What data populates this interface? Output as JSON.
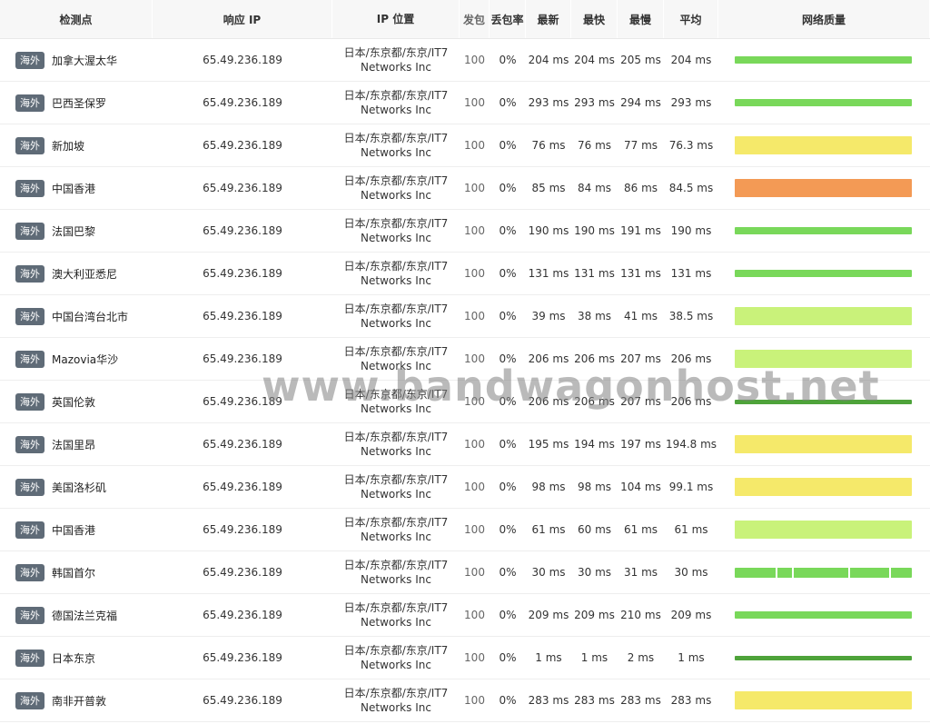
{
  "columns": {
    "node": "检测点",
    "ip": "响应 IP",
    "location": "IP 位置",
    "sent": "发包",
    "loss": "丢包率",
    "latest": "最新",
    "fastest": "最快",
    "slowest": "最慢",
    "average": "平均",
    "quality": "网络质量"
  },
  "colors": {
    "green": "#79d85a",
    "dark_green": "#4ea33a",
    "light_green": "#c9f27a",
    "yellow": "#f5e96a",
    "orange": "#f39a55",
    "tag_bg": "#5f6b77"
  },
  "rows": [
    {
      "tag": "海外",
      "node": "加拿大渥太华",
      "ip": "65.49.236.189",
      "loc1": "日本/东京都/东京/IT7",
      "loc2": "Networks Inc",
      "sent": "100",
      "loss": "0%",
      "latest": "204 ms",
      "fastest": "204 ms",
      "slowest": "205 ms",
      "average": "204 ms",
      "quality": "green"
    },
    {
      "tag": "海外",
      "node": "巴西圣保罗",
      "ip": "65.49.236.189",
      "loc1": "日本/东京都/东京/IT7",
      "loc2": "Networks Inc",
      "sent": "100",
      "loss": "0%",
      "latest": "293 ms",
      "fastest": "293 ms",
      "slowest": "294 ms",
      "average": "293 ms",
      "quality": "green"
    },
    {
      "tag": "海外",
      "node": "新加坡",
      "ip": "65.49.236.189",
      "loc1": "日本/东京都/东京/IT7",
      "loc2": "Networks Inc",
      "sent": "100",
      "loss": "0%",
      "latest": "76 ms",
      "fastest": "76 ms",
      "slowest": "77 ms",
      "average": "76.3 ms",
      "quality": "yellow"
    },
    {
      "tag": "海外",
      "node": "中国香港",
      "ip": "65.49.236.189",
      "loc1": "日本/东京都/东京/IT7",
      "loc2": "Networks Inc",
      "sent": "100",
      "loss": "0%",
      "latest": "85 ms",
      "fastest": "84 ms",
      "slowest": "86 ms",
      "average": "84.5 ms",
      "quality": "orange"
    },
    {
      "tag": "海外",
      "node": "法国巴黎",
      "ip": "65.49.236.189",
      "loc1": "日本/东京都/东京/IT7",
      "loc2": "Networks Inc",
      "sent": "100",
      "loss": "0%",
      "latest": "190 ms",
      "fastest": "190 ms",
      "slowest": "191 ms",
      "average": "190 ms",
      "quality": "green"
    },
    {
      "tag": "海外",
      "node": "澳大利亚悉尼",
      "ip": "65.49.236.189",
      "loc1": "日本/东京都/东京/IT7",
      "loc2": "Networks Inc",
      "sent": "100",
      "loss": "0%",
      "latest": "131 ms",
      "fastest": "131 ms",
      "slowest": "131 ms",
      "average": "131 ms",
      "quality": "green"
    },
    {
      "tag": "海外",
      "node": "中国台湾台北市",
      "ip": "65.49.236.189",
      "loc1": "日本/东京都/东京/IT7",
      "loc2": "Networks Inc",
      "sent": "100",
      "loss": "0%",
      "latest": "39 ms",
      "fastest": "38 ms",
      "slowest": "41 ms",
      "average": "38.5 ms",
      "quality": "light_green"
    },
    {
      "tag": "海外",
      "node": "Mazovia华沙",
      "ip": "65.49.236.189",
      "loc1": "日本/东京都/东京/IT7",
      "loc2": "Networks Inc",
      "sent": "100",
      "loss": "0%",
      "latest": "206 ms",
      "fastest": "206 ms",
      "slowest": "207 ms",
      "average": "206 ms",
      "quality": "light_green"
    },
    {
      "tag": "海外",
      "node": "英国伦敦",
      "ip": "65.49.236.189",
      "loc1": "日本/东京都/东京/IT7",
      "loc2": "Networks Inc",
      "sent": "100",
      "loss": "0%",
      "latest": "206 ms",
      "fastest": "206 ms",
      "slowest": "207 ms",
      "average": "206 ms",
      "quality": "dark_green"
    },
    {
      "tag": "海外",
      "node": "法国里昂",
      "ip": "65.49.236.189",
      "loc1": "日本/东京都/东京/IT7",
      "loc2": "Networks Inc",
      "sent": "100",
      "loss": "0%",
      "latest": "195 ms",
      "fastest": "194 ms",
      "slowest": "197 ms",
      "average": "194.8 ms",
      "quality": "yellow"
    },
    {
      "tag": "海外",
      "node": "美国洛杉矶",
      "ip": "65.49.236.189",
      "loc1": "日本/东京都/东京/IT7",
      "loc2": "Networks Inc",
      "sent": "100",
      "loss": "0%",
      "latest": "98 ms",
      "fastest": "98 ms",
      "slowest": "104 ms",
      "average": "99.1 ms",
      "quality": "yellow"
    },
    {
      "tag": "海外",
      "node": "中国香港",
      "ip": "65.49.236.189",
      "loc1": "日本/东京都/东京/IT7",
      "loc2": "Networks Inc",
      "sent": "100",
      "loss": "0%",
      "latest": "61 ms",
      "fastest": "60 ms",
      "slowest": "61 ms",
      "average": "61 ms",
      "quality": "light_green"
    },
    {
      "tag": "海外",
      "node": "韩国首尔",
      "ip": "65.49.236.189",
      "loc1": "日本/东京都/东京/IT7",
      "loc2": "Networks Inc",
      "sent": "100",
      "loss": "0%",
      "latest": "30 ms",
      "fastest": "30 ms",
      "slowest": "31 ms",
      "average": "30 ms",
      "quality": "green_gap"
    },
    {
      "tag": "海外",
      "node": "德国法兰克福",
      "ip": "65.49.236.189",
      "loc1": "日本/东京都/东京/IT7",
      "loc2": "Networks Inc",
      "sent": "100",
      "loss": "0%",
      "latest": "209 ms",
      "fastest": "209 ms",
      "slowest": "210 ms",
      "average": "209 ms",
      "quality": "green"
    },
    {
      "tag": "海外",
      "node": "日本东京",
      "ip": "65.49.236.189",
      "loc1": "日本/东京都/东京/IT7",
      "loc2": "Networks Inc",
      "sent": "100",
      "loss": "0%",
      "latest": "1 ms",
      "fastest": "1 ms",
      "slowest": "2 ms",
      "average": "1 ms",
      "quality": "dark_green"
    },
    {
      "tag": "海外",
      "node": "南非开普敦",
      "ip": "65.49.236.189",
      "loc1": "日本/东京都/东京/IT7",
      "loc2": "Networks Inc",
      "sent": "100",
      "loss": "0%",
      "latest": "283 ms",
      "fastest": "283 ms",
      "slowest": "283 ms",
      "average": "283 ms",
      "quality": "yellow"
    }
  ],
  "watermark": "www.bandwagonhost.net"
}
